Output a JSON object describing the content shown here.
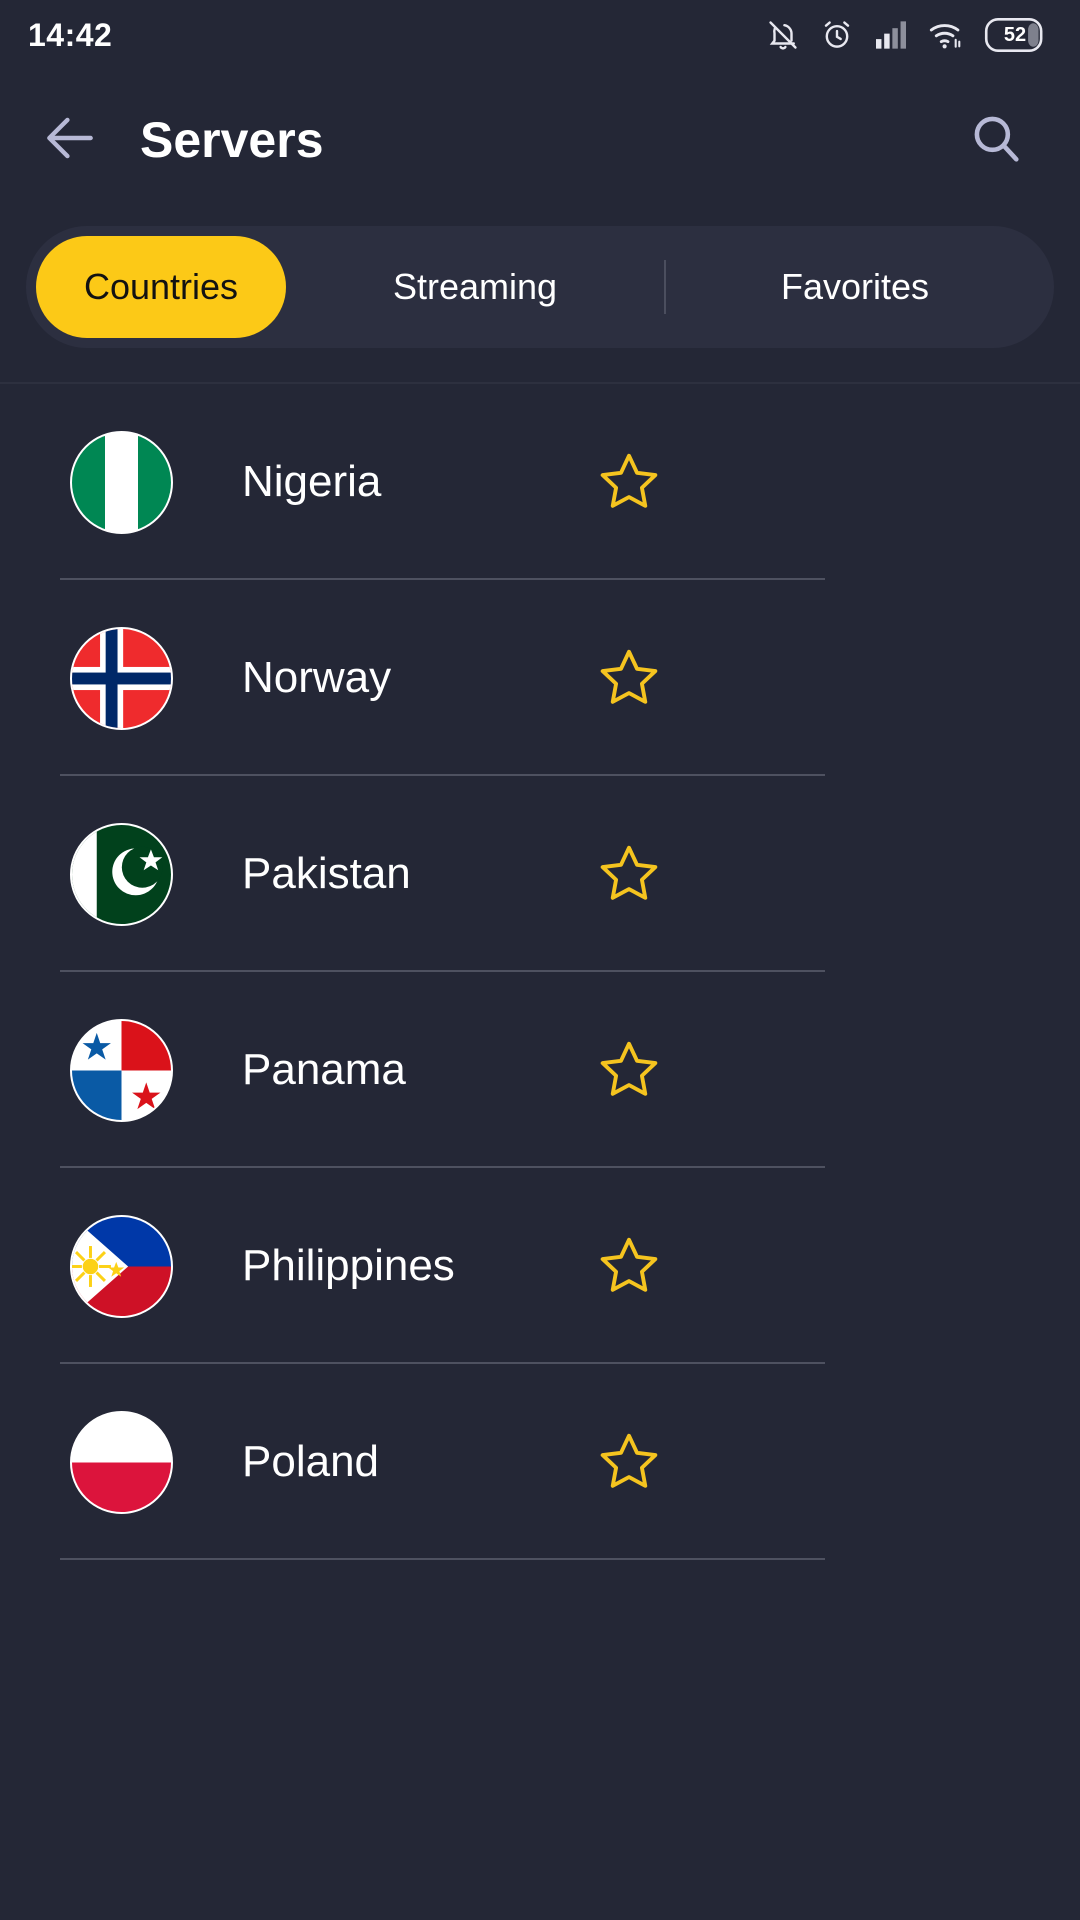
{
  "status_bar": {
    "time": "14:42",
    "battery_level": "52",
    "icons": [
      "notifications-off-icon",
      "alarm-icon",
      "cellular-signal-icon",
      "wifi-icon",
      "battery-icon"
    ]
  },
  "app_bar": {
    "back_label": "back-arrow-icon",
    "title": "Servers",
    "search_label": "search-icon"
  },
  "tabs": [
    {
      "label": "Countries",
      "active": true
    },
    {
      "label": "Streaming",
      "active": false
    },
    {
      "label": "Favorites",
      "active": false
    }
  ],
  "colors": {
    "background": "#242736",
    "tab_bar": "#2c2f40",
    "accent": "#fcc917",
    "accent_text": "#121212",
    "text": "#ffffff",
    "icon_tint": "#b7b9d6",
    "divider": "#4e5160",
    "star": "#f5c41f"
  },
  "list": {
    "rows": [
      {
        "name": "Nigeria",
        "flag": "flag-nigeria-icon",
        "favorite": false,
        "star_label": "favorite-star-icon"
      },
      {
        "name": "Norway",
        "flag": "flag-norway-icon",
        "favorite": false,
        "star_label": "favorite-star-icon"
      },
      {
        "name": "Pakistan",
        "flag": "flag-pakistan-icon",
        "favorite": false,
        "star_label": "favorite-star-icon"
      },
      {
        "name": "Panama",
        "flag": "flag-panama-icon",
        "favorite": false,
        "star_label": "favorite-star-icon"
      },
      {
        "name": "Philippines",
        "flag": "flag-philippines-icon",
        "favorite": false,
        "star_label": "favorite-star-icon"
      },
      {
        "name": "Poland",
        "flag": "flag-poland-icon",
        "favorite": false,
        "star_label": "favorite-star-icon"
      }
    ]
  }
}
